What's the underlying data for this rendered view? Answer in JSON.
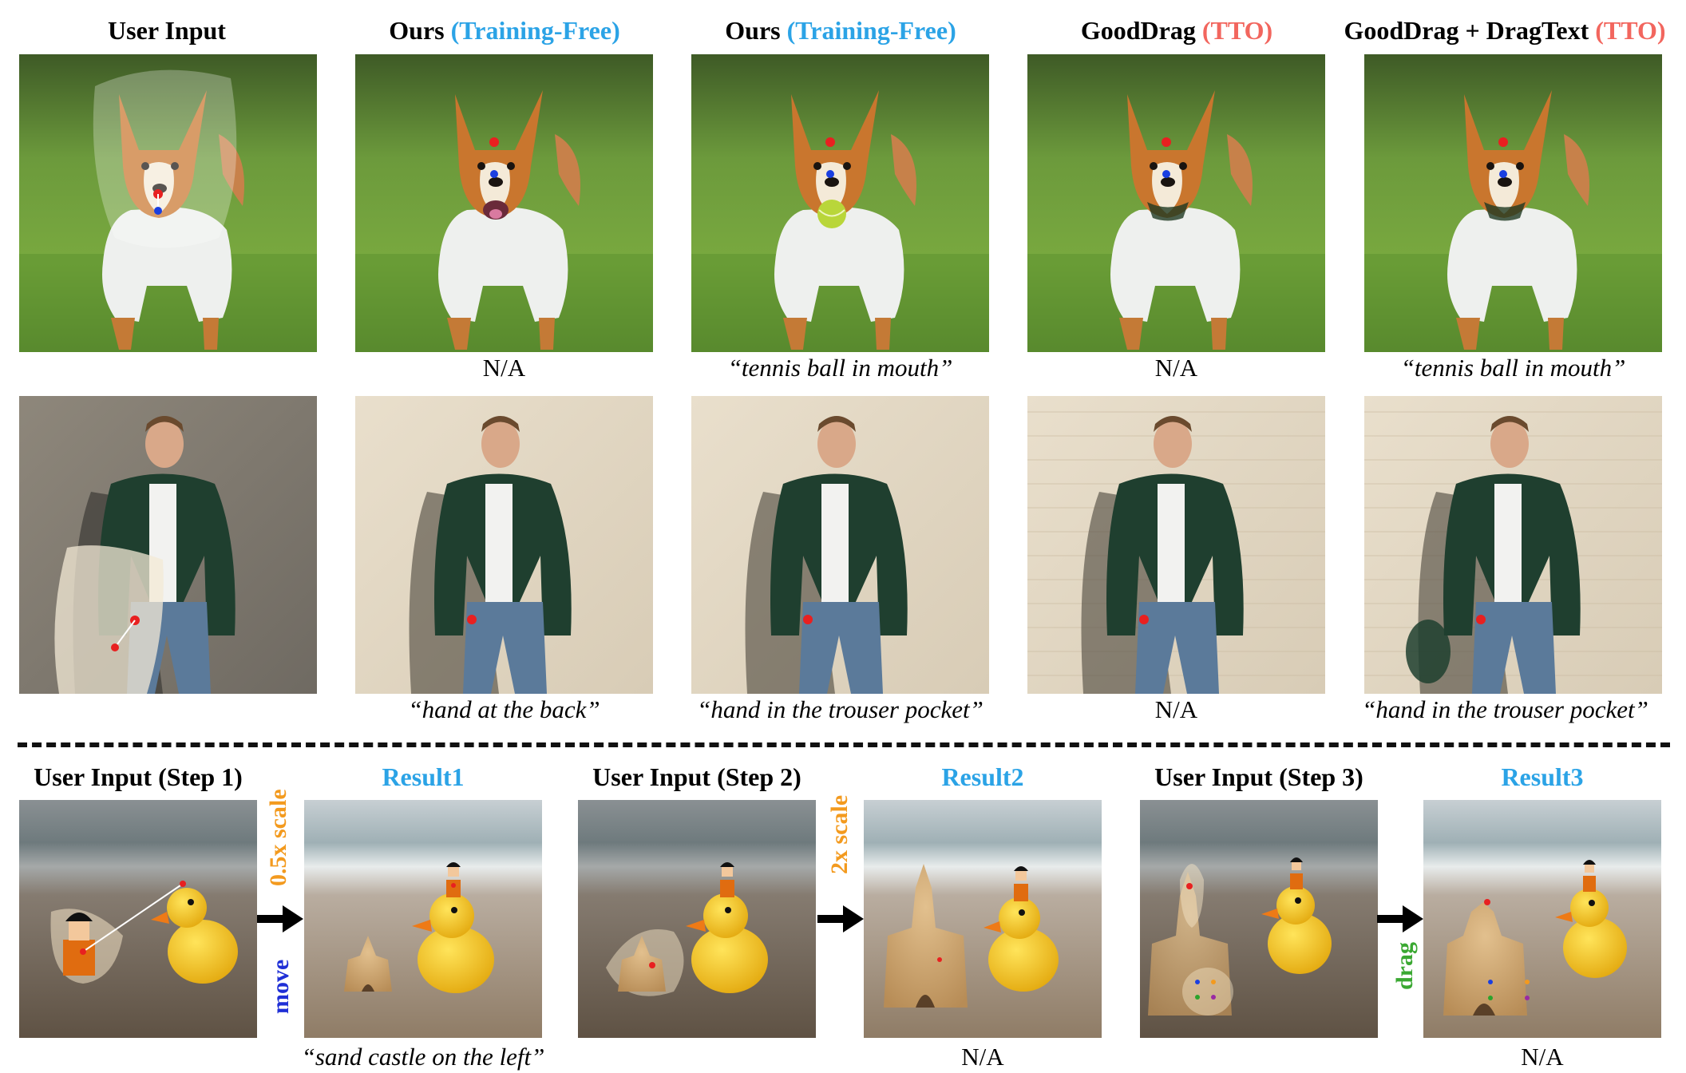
{
  "top_headers": {
    "user_input": "User Input",
    "ours": "Ours",
    "training_free": "(Training-Free)",
    "gooddrag": "GoodDrag",
    "gooddrag_dragtext": "GoodDrag + DragText",
    "tto": "(TTO)"
  },
  "row1_captions": [
    "N/A",
    "“tennis ball in mouth”",
    "N/A",
    "“tennis ball in mouth”"
  ],
  "row2_captions": [
    "“hand at the back”",
    "“hand in the trouser pocket”",
    "N/A",
    "“hand in the trouser pocket”"
  ],
  "bottom_headers": {
    "step1": "User Input (Step 1)",
    "result1": "Result1",
    "step2": "User Input (Step 2)",
    "result2": "Result2",
    "step3": "User Input (Step 3)",
    "result3": "Result3"
  },
  "operations": {
    "scale_half": "0.5x scale",
    "move": "move",
    "scale_double": "2x scale",
    "drag": "drag"
  },
  "bottom_captions": {
    "result1": "“sand castle on the left”",
    "result2": "N/A",
    "result3": "N/A"
  },
  "colors": {
    "training_free": "#2ba3e6",
    "tto": "#f2665e",
    "result_title": "#2ba3e6",
    "scale_op": "#f39a1e",
    "move_op": "#1f2fd6",
    "drag_op": "#3aa832"
  }
}
